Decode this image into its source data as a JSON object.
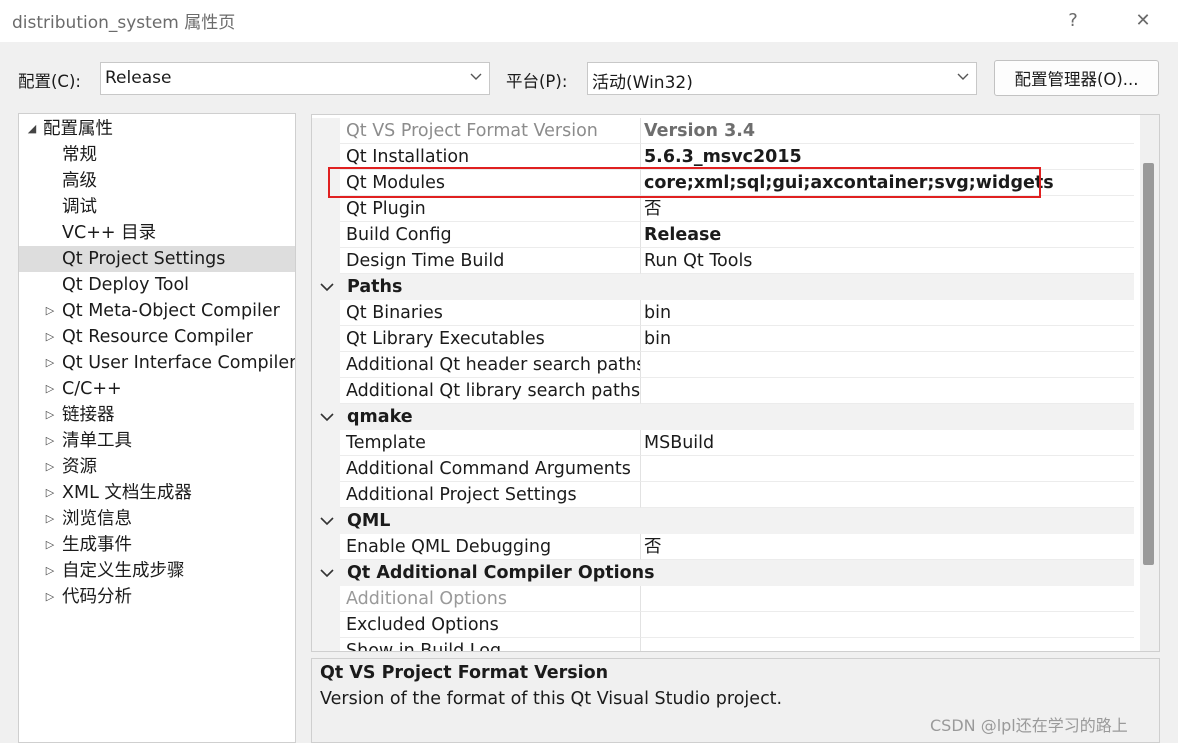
{
  "window": {
    "title": "distribution_system 属性页",
    "help_glyph": "?",
    "close_glyph": "✕"
  },
  "config_bar": {
    "config_label": "配置(C):",
    "config_value": "Release",
    "platform_label": "平台(P):",
    "platform_value": "活动(Win32)",
    "manager_button": "配置管理器(O)..."
  },
  "tree": {
    "root": "配置属性",
    "items": [
      {
        "label": "常规",
        "expandable": false,
        "selected": false
      },
      {
        "label": "高级",
        "expandable": false,
        "selected": false
      },
      {
        "label": "调试",
        "expandable": false,
        "selected": false
      },
      {
        "label": "VC++ 目录",
        "expandable": false,
        "selected": false
      },
      {
        "label": "Qt Project Settings",
        "expandable": false,
        "selected": true
      },
      {
        "label": "Qt Deploy Tool",
        "expandable": false,
        "selected": false
      },
      {
        "label": "Qt Meta-Object Compiler",
        "expandable": true,
        "selected": false
      },
      {
        "label": "Qt Resource Compiler",
        "expandable": true,
        "selected": false
      },
      {
        "label": "Qt User Interface Compiler",
        "expandable": true,
        "selected": false
      },
      {
        "label": "C/C++",
        "expandable": true,
        "selected": false
      },
      {
        "label": "链接器",
        "expandable": true,
        "selected": false
      },
      {
        "label": "清单工具",
        "expandable": true,
        "selected": false
      },
      {
        "label": "资源",
        "expandable": true,
        "selected": false
      },
      {
        "label": "XML 文档生成器",
        "expandable": true,
        "selected": false
      },
      {
        "label": "浏览信息",
        "expandable": true,
        "selected": false
      },
      {
        "label": "生成事件",
        "expandable": true,
        "selected": false
      },
      {
        "label": "自定义生成步骤",
        "expandable": true,
        "selected": false
      },
      {
        "label": "代码分析",
        "expandable": true,
        "selected": false
      }
    ]
  },
  "grid": {
    "rows": [
      {
        "kind": "prop",
        "name": "Qt VS Project Format Version",
        "value": "Version 3.4",
        "name_gray": true,
        "value_bold": true,
        "value_gray": true
      },
      {
        "kind": "prop",
        "name": "Qt Installation",
        "value": "5.6.3_msvc2015",
        "value_bold": true
      },
      {
        "kind": "prop",
        "name": "Qt Modules",
        "value": "core;xml;sql;gui;axcontainer;svg;widgets",
        "value_bold": true
      },
      {
        "kind": "prop",
        "name": "Qt Plugin",
        "value": "否"
      },
      {
        "kind": "prop",
        "name": "Build Config",
        "value": "Release",
        "value_bold": true
      },
      {
        "kind": "prop",
        "name": "Design Time Build",
        "value": "Run Qt Tools"
      },
      {
        "kind": "cat",
        "name": "Paths"
      },
      {
        "kind": "prop",
        "name": "Qt Binaries",
        "value": "bin"
      },
      {
        "kind": "prop",
        "name": "Qt Library Executables",
        "value": "bin"
      },
      {
        "kind": "prop",
        "name": "Additional Qt header search paths",
        "value": ""
      },
      {
        "kind": "prop",
        "name": "Additional Qt library search paths",
        "value": ""
      },
      {
        "kind": "cat",
        "name": "qmake"
      },
      {
        "kind": "prop",
        "name": "Template",
        "value": "MSBuild"
      },
      {
        "kind": "prop",
        "name": "Additional Command Arguments",
        "value": ""
      },
      {
        "kind": "prop",
        "name": "Additional Project Settings",
        "value": ""
      },
      {
        "kind": "cat",
        "name": "QML"
      },
      {
        "kind": "prop",
        "name": "Enable QML Debugging",
        "value": "否"
      },
      {
        "kind": "cat",
        "name": "Qt Additional Compiler Options"
      },
      {
        "kind": "prop",
        "name": "Additional Options",
        "value": "",
        "name_faded": true
      },
      {
        "kind": "prop",
        "name": "Excluded Options",
        "value": ""
      },
      {
        "kind": "prop",
        "name": "Show in Build Log",
        "value": ""
      }
    ]
  },
  "description": {
    "title": "Qt VS Project Format Version",
    "body": "Version of the format of this Qt Visual Studio project."
  },
  "watermark": "CSDN @lpl还在学习的路上",
  "colors": {
    "highlight_border": "#e02020",
    "selected_bg": "#dddddd"
  }
}
